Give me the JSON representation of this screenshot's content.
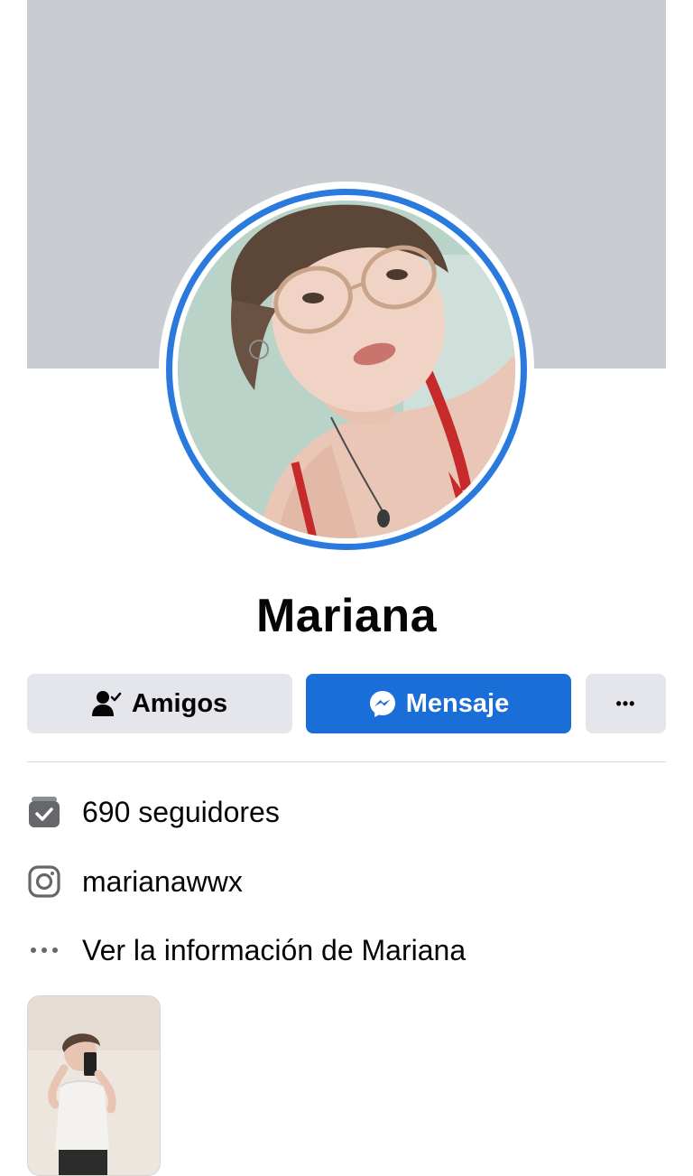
{
  "profile": {
    "name": "Mariana"
  },
  "actions": {
    "friends_label": "Amigos",
    "message_label": "Mensaje",
    "more_label": "•••"
  },
  "info": {
    "followers": "690 seguidores",
    "instagram": "marianawwx",
    "about": "Ver la información de Mariana"
  },
  "icons": {
    "friends": "person-check-icon",
    "message": "messenger-icon",
    "more": "more-dots-icon",
    "followers": "followers-check-icon",
    "instagram": "instagram-icon",
    "about": "more-dots-icon"
  },
  "colors": {
    "accent": "#1a6ed8",
    "story_ring": "#2a7ade",
    "cover": "#c9ccd1",
    "button_gray": "#e4e6eb",
    "text": "#050505",
    "icon_gray": "#65676b"
  }
}
